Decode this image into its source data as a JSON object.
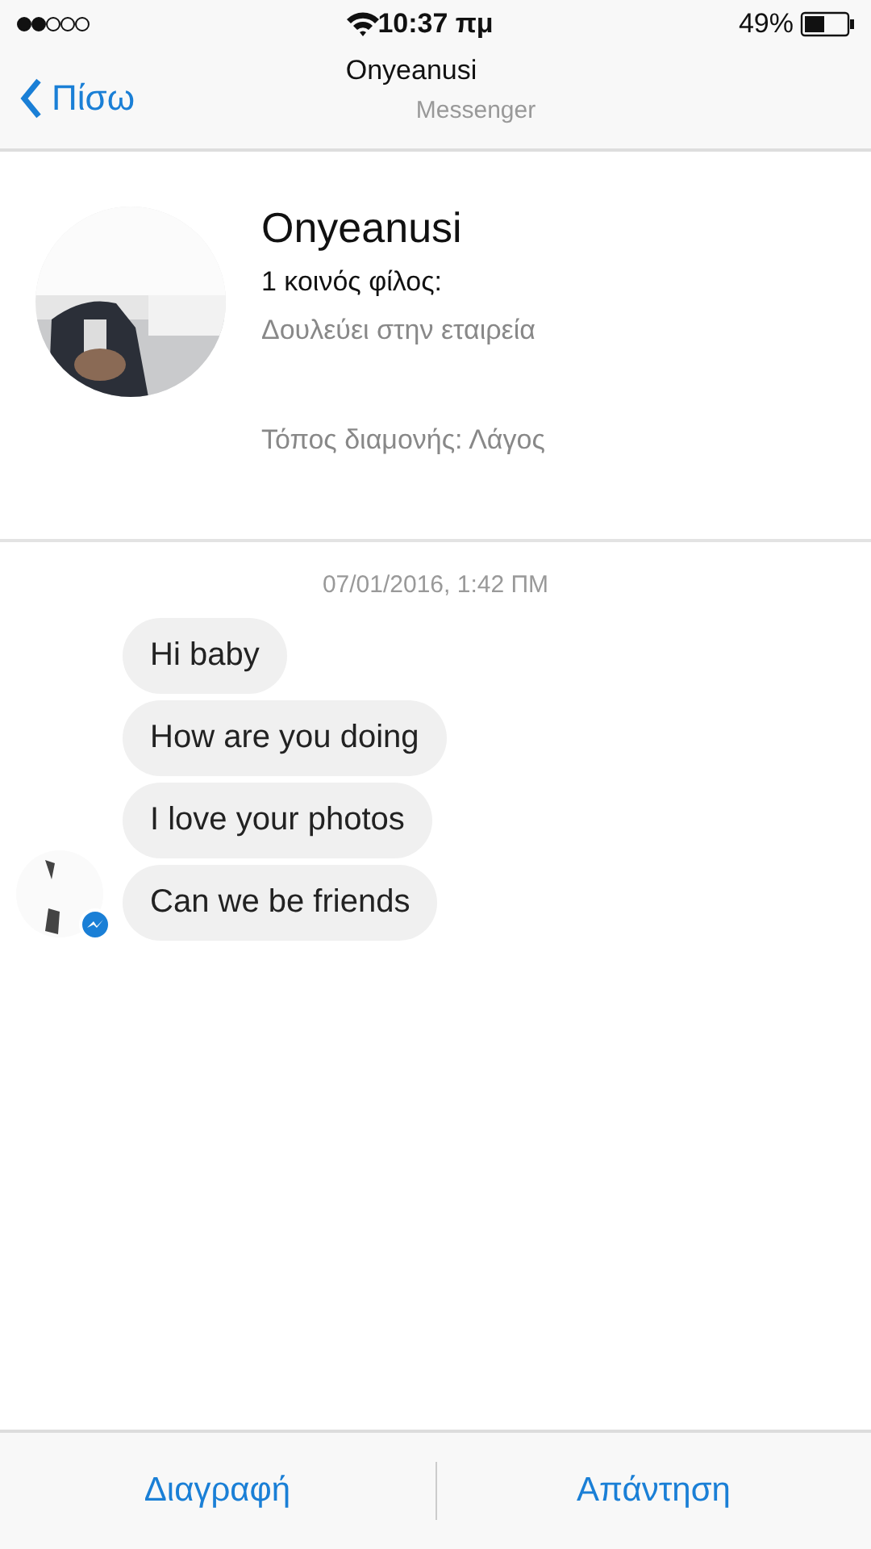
{
  "status_bar": {
    "time": "10:37 πμ",
    "battery": "49%"
  },
  "nav": {
    "back": "Πίσω",
    "title": "Onyeanusi",
    "subtitle": "Messenger"
  },
  "profile": {
    "name": "Onyeanusi",
    "mutual": "1 κοινός φίλος:",
    "work": "Δουλεύει στην εταιρεία",
    "location": "Τόπος διαμονής: Λάγος"
  },
  "conversation": {
    "timestamp": "07/01/2016, 1:42 ΠΜ",
    "messages": [
      {
        "text": "Hi baby"
      },
      {
        "text": "How are you doing"
      },
      {
        "text": "I love your photos"
      },
      {
        "text": "Can we be friends"
      }
    ]
  },
  "actions": [
    "Διαγραφή",
    "Απάντηση"
  ]
}
